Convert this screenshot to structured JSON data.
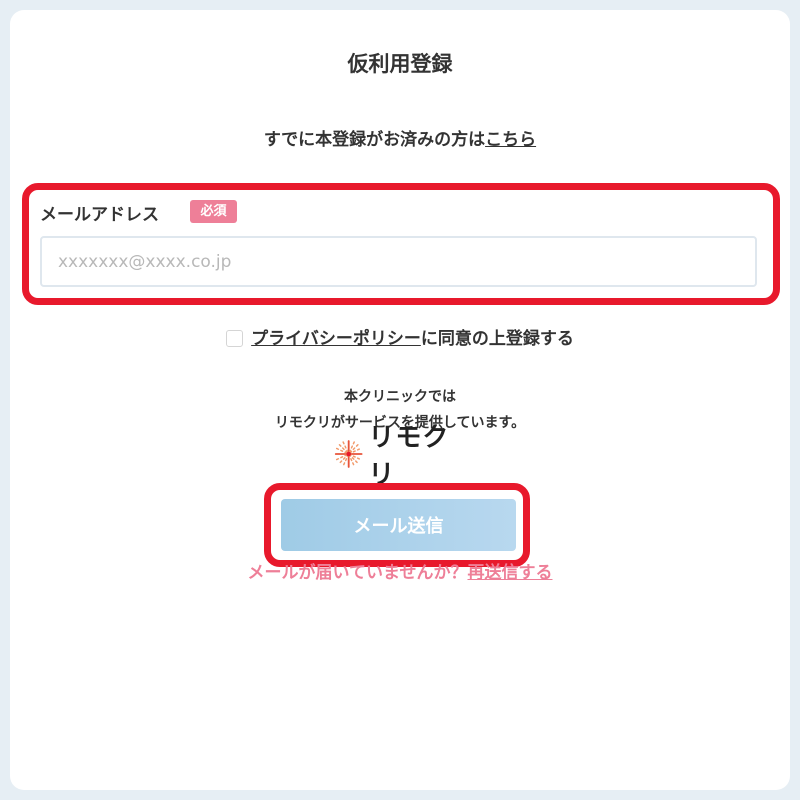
{
  "page": {
    "title": "仮利用登録",
    "already_text": "すでに本登録がお済みの方は",
    "already_link": "こちら"
  },
  "email": {
    "label": "メールアドレス",
    "required_badge": "必須",
    "placeholder": "xxxxxxx@xxxx.co.jp",
    "value": ""
  },
  "consent": {
    "checked": false,
    "policy_link": "プライバシーポリシー",
    "suffix": "に同意の上登録する"
  },
  "info": {
    "line1": "本クリニックでは",
    "line2": "リモクリがサービスを提供しています。"
  },
  "logo": {
    "text": "リモクリ",
    "icon": "sparkle-logo-icon"
  },
  "actions": {
    "send_label": "メール送信",
    "resend_text": "メールが届いていませんか？",
    "resend_link": "再送信する"
  },
  "colors": {
    "highlight": "#e8192c",
    "accent_pink": "#ee7f98",
    "button": "#a8d0ea"
  }
}
